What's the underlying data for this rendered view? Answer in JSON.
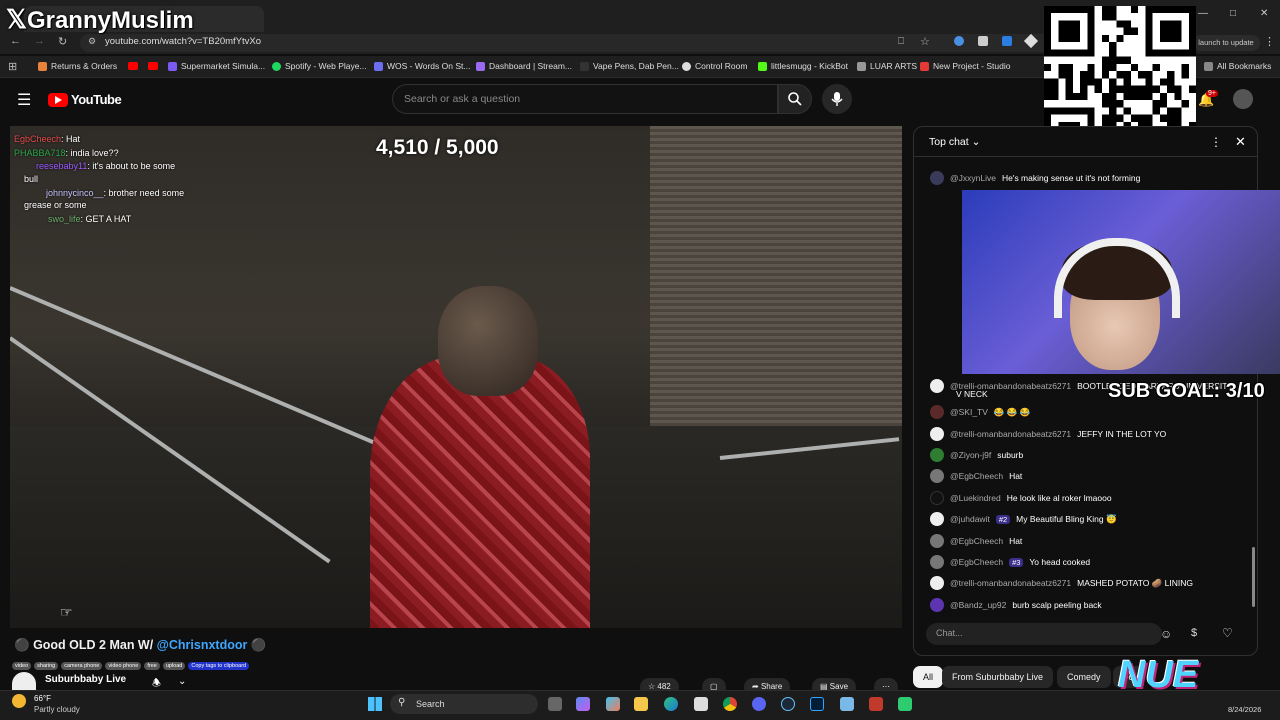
{
  "overlay_logo": "GrannyMuslim",
  "browser": {
    "url": "youtube.com/watch?v=TB20mfYtvXo",
    "update_button": "launch to update",
    "bookmarks": [
      {
        "label": "Returns & Orders",
        "color": "#e8823c"
      },
      {
        "label": "Supermarket Simula...",
        "color": "#7a5af0"
      },
      {
        "label": "Spotify - Web Playe...",
        "color": "#1ed760"
      },
      {
        "label": "WOS - Words On St...",
        "color": "#6d6df0"
      },
      {
        "label": "Dashboard | Stream...",
        "color": "#9a6af0"
      },
      {
        "label": "Vape Pens, Dab Pen...",
        "color": "#333333"
      },
      {
        "label": "Control Room",
        "color": "#dddddd"
      },
      {
        "label": "littlesmugg - KickBot",
        "color": "#53fc18"
      },
      {
        "label": "LUAR ARTS",
        "color": "#999999"
      },
      {
        "label": "New Project - Studio",
        "color": "#e53935"
      },
      {
        "label": "All Bookmarks",
        "color": "#888888"
      }
    ]
  },
  "youtube": {
    "logo": "YouTube",
    "search_placeholder": "Search or ask a question",
    "notification_count": "9+"
  },
  "video": {
    "counter": "4,510 / 5,000",
    "overlay_chat": [
      {
        "author": "EgbCheech",
        "text": ": Hat",
        "color": "#e14b4b"
      },
      {
        "author": "PHABBA718",
        "text": ": india love??",
        "color": "#2aa84a"
      },
      {
        "author": "reesebaby11",
        "text": ": it's about to be some",
        "color": "#9b59ff"
      },
      {
        "author": "",
        "text": "bull",
        "color": "#ffffff"
      },
      {
        "author": "johnnycinco__",
        "text": ": brother need some",
        "color": "#c5c5ff"
      },
      {
        "author": "",
        "text": "grease or some",
        "color": "#ffffff"
      },
      {
        "author": "swo_life",
        "text": ": GET A HAT",
        "color": "#6fae6f"
      }
    ],
    "title_prefix": "Good OLD 2 Man W/ ",
    "title_mention": "@Chrisnxtdoor",
    "tags": [
      "video",
      "sharing",
      "camera phone",
      "video phone",
      "free",
      "upload"
    ],
    "copy_tags": "Copy tags to clipboard",
    "channel": "Suburbbaby Live",
    "like_count": "482",
    "share_label": "Share",
    "save_label": "Save"
  },
  "chat": {
    "header": "Top chat",
    "messages": [
      {
        "author": "@JxxynLive",
        "text": "He's making sense ut it's not forming",
        "avatar": "#3a3a5a"
      },
      {
        "author": "@trelli-omanbandonabeatz6271",
        "text": "BOOTLEGGED HARVARD UNIVERSITY",
        "avatar": "#eeeeee"
      },
      {
        "author": "",
        "text": "V NECK",
        "avatar": ""
      },
      {
        "author": "@SKI_TV",
        "text": "😂 😂 😂",
        "avatar": "#5a2a2a"
      },
      {
        "author": "@trelli-omanbandonabeatz6271",
        "text": "JEFFY IN THE LOT YO",
        "avatar": "#eeeeee"
      },
      {
        "author": "@Ziyon-j9f",
        "text": "suburb",
        "avatar": "#2e7d32"
      },
      {
        "author": "@EgbCheech",
        "text": "Hat",
        "avatar": "#777777"
      },
      {
        "author": "@Luekindred",
        "text": "He look like al roker lmaooo",
        "avatar": "#111111"
      },
      {
        "author": "@juhdawit",
        "text": "My Beautiful Bling King 😇",
        "badge": "#2",
        "avatar": "#eeeeee"
      },
      {
        "author": "@EgbCheech",
        "text": "Hat",
        "avatar": "#777777"
      },
      {
        "author": "@EgbCheech",
        "text": "Yo head cooked",
        "badge": "#3",
        "avatar": "#777777"
      },
      {
        "author": "@trelli-omanbandonabeatz6271",
        "text": "MASHED POTATO 🥔 LINING",
        "avatar": "#eeeeee"
      },
      {
        "author": "@Bandz_up92",
        "text": "burb scalp peeling back",
        "avatar": "#5e35b1"
      }
    ],
    "input_placeholder": "Chat...",
    "sub_goal": "SUB GOAL: 3/10"
  },
  "chips": [
    "All",
    "From Suburbbaby Live",
    "Comedy",
    "Fo"
  ],
  "nue_logo": "NUE",
  "taskbar": {
    "weather_temp": "66°F",
    "weather_desc": "Partly cloudy",
    "search_label": "Search",
    "date": "8/24/2026"
  }
}
